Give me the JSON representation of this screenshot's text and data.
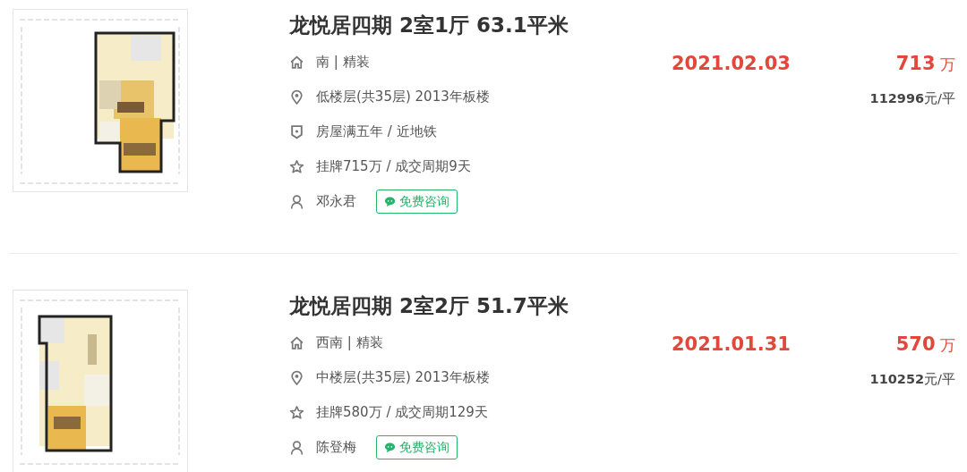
{
  "listings": [
    {
      "title": "龙悦居四期 2室1厅 63.1平米",
      "details": [
        {
          "kind": "home",
          "text": "南 | 精装"
        },
        {
          "kind": "location",
          "text": "低楼层(共35层) 2013年板楼"
        },
        {
          "kind": "shield",
          "text": "房屋满五年 / 近地铁"
        },
        {
          "kind": "star",
          "text": "挂牌715万 / 成交周期9天"
        }
      ],
      "agent": {
        "name": "邓永君",
        "button": "免费咨询"
      },
      "date": "2021.02.03",
      "price": "713",
      "price_unit": "万",
      "unit_price": "**112996**元/平"
    },
    {
      "title": "龙悦居四期 2室2厅 51.7平米",
      "details": [
        {
          "kind": "home",
          "text": "西南 | 精装"
        },
        {
          "kind": "location",
          "text": "中楼层(共35层) 2013年板楼"
        },
        {
          "kind": "star",
          "text": "挂牌580万 / 成交周期129天"
        }
      ],
      "agent": {
        "name": "陈登梅",
        "button": "免费咨询"
      },
      "date": "2021.01.31",
      "price": "570",
      "price_unit": "万",
      "unit_price": "**110252**元/平"
    }
  ]
}
